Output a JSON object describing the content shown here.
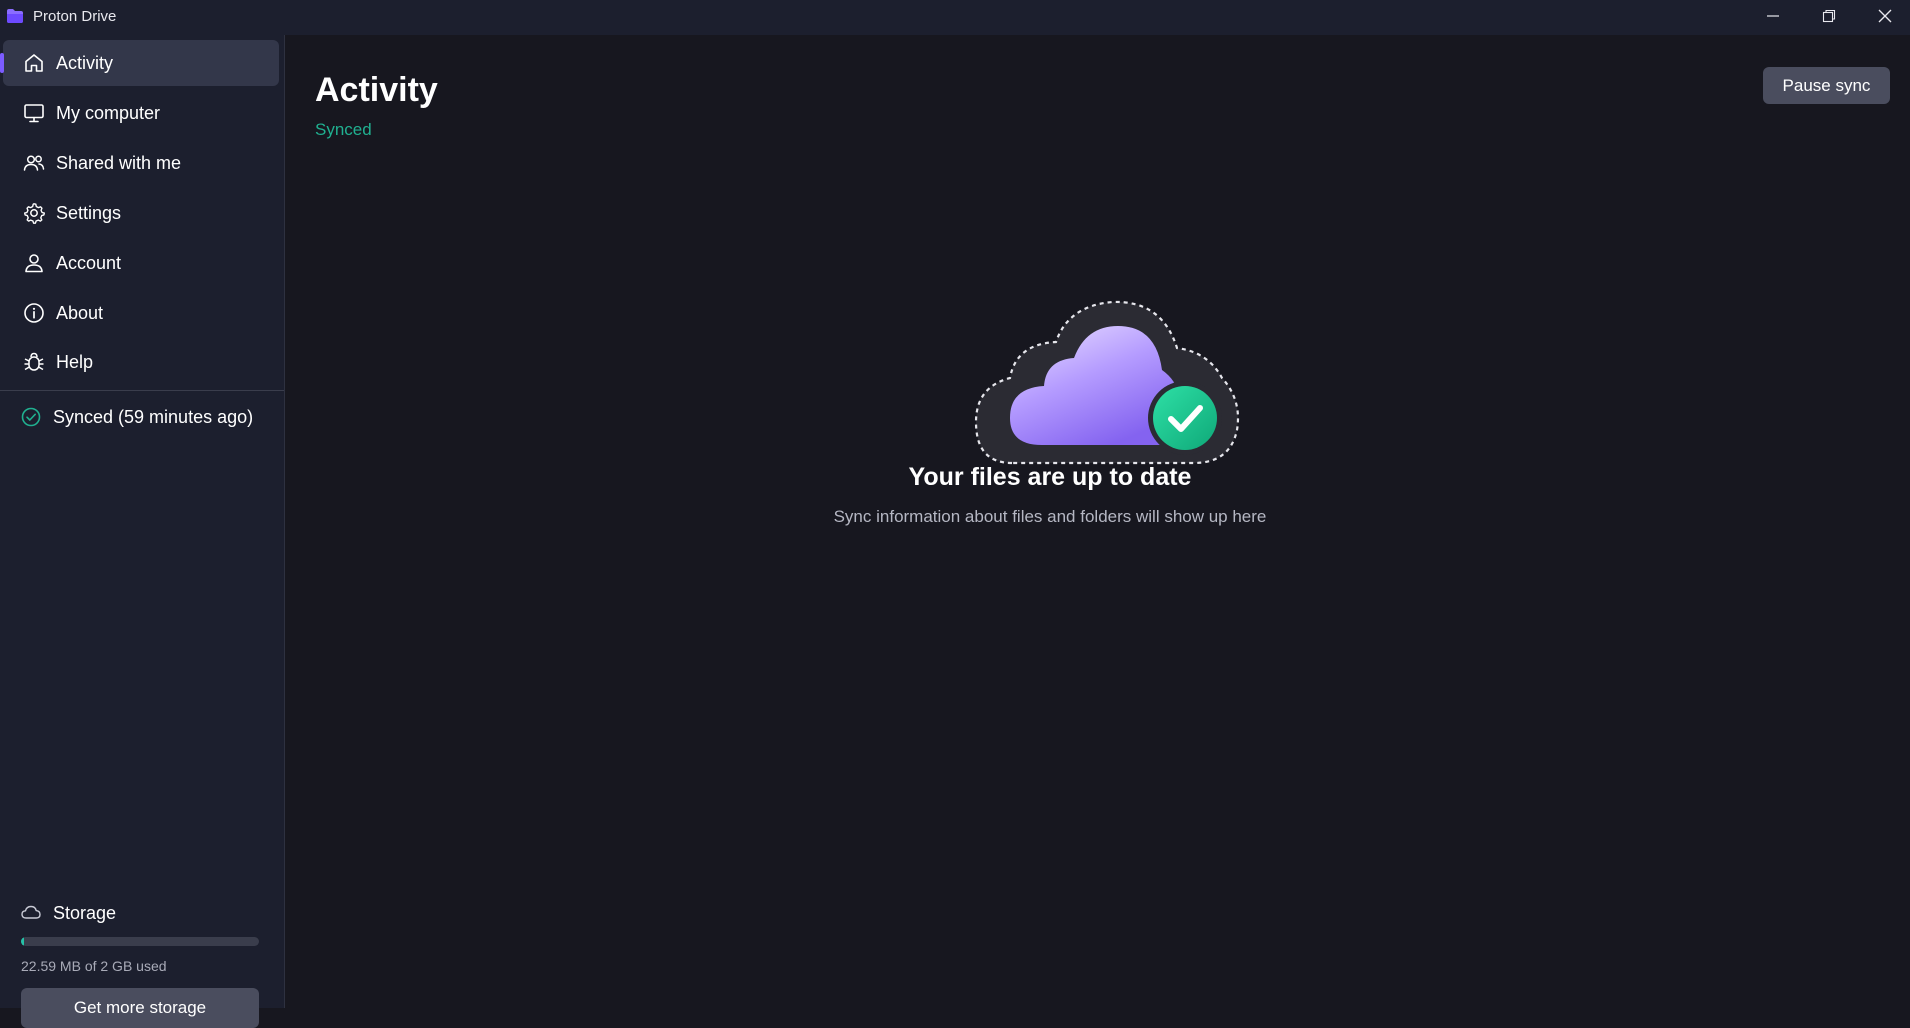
{
  "window": {
    "title": "Proton Drive",
    "controls": [
      "minimize",
      "restore",
      "close"
    ]
  },
  "sidebar": {
    "items": [
      {
        "label": "Activity",
        "icon": "home-icon",
        "active": true
      },
      {
        "label": "My computer",
        "icon": "monitor-icon"
      },
      {
        "label": "Shared with me",
        "icon": "users-icon"
      },
      {
        "label": "Settings",
        "icon": "gear-icon"
      },
      {
        "label": "Account",
        "icon": "user-icon"
      },
      {
        "label": "About",
        "icon": "info-icon"
      },
      {
        "label": "Help",
        "icon": "bug-icon"
      }
    ],
    "sync_status": "Synced (59 minutes ago)",
    "storage": {
      "label": "Storage",
      "used_text": "22.59 MB of 2 GB used",
      "used_fraction": 0.011,
      "button": "Get more storage"
    }
  },
  "main": {
    "title": "Activity",
    "status": "Synced",
    "pause_button": "Pause sync",
    "empty_title": "Your files are up to date",
    "empty_subtitle": "Sync information about files and folders will show up here"
  },
  "colors": {
    "accent": "#7c5cff",
    "synced": "#20b090",
    "check": "#19c08f",
    "storage_fill": "#26c2a8"
  }
}
